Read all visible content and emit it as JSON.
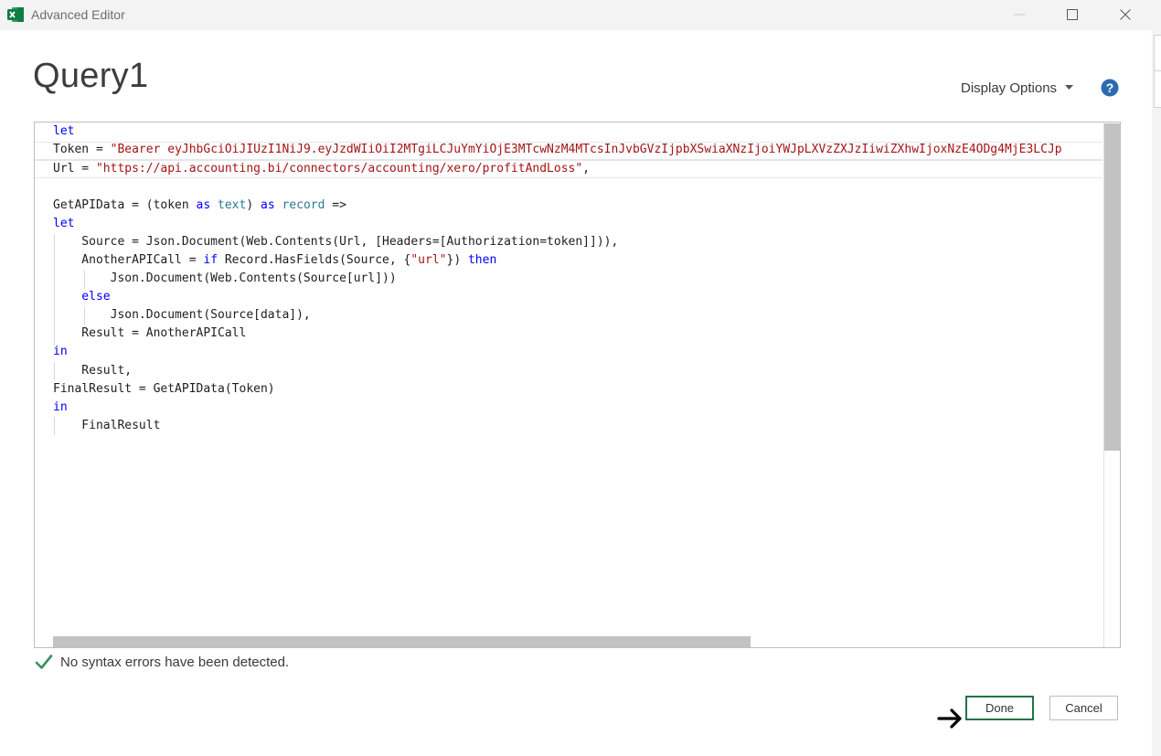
{
  "window": {
    "title": "Advanced Editor",
    "app_icon": "excel-icon",
    "controls": [
      "minimize-icon",
      "maximize-icon",
      "close-icon"
    ]
  },
  "header": {
    "query_name": "Query1",
    "display_options_label": "Display Options",
    "help_icon": "help-icon"
  },
  "code": {
    "line1_let": "let",
    "line2_name": "Token = ",
    "line2_string": "\"Bearer eyJhbGciOiJIUzI1NiJ9.eyJzdWIiOiI2MTgiLCJuYmYiOjE3MTcwNzM4MTcsInJvbGVzIjpbXSwiaXNzIjoiYWJpLXVzZXJzIiwiZXhwIjoxNzE4ODg4MjE3LCJp",
    "line3_name": "Url = ",
    "line3_string": "\"https://api.accounting.bi/connectors/accounting/xero/profitAndLoss\"",
    "line3_tail": ",",
    "line5_a": "GetAPIData = (token ",
    "line5_as1": "as",
    "line5_text": "text",
    "line5_b": ") ",
    "line5_as2": "as",
    "line5_record": "record",
    "line5_c": " =>",
    "line6_let": "let",
    "line7": "    Source = Json.Document(Web.Contents(Url, [Headers=[Authorization=token]])),",
    "line8_a": "    AnotherAPICall = ",
    "line8_if": "if",
    "line8_b": " Record.HasFields(Source, {",
    "line8_str": "\"url\"",
    "line8_c": "}) ",
    "line8_then": "then",
    "line9": "        Json.Document(Web.Contents(Source[url]))",
    "line10_else": "    else",
    "line11": "        Json.Document(Source[data]),",
    "line12": "    Result = AnotherAPICall",
    "line13_in": "in",
    "line14": "    Result,",
    "line15": "FinalResult = GetAPIData(Token)",
    "line16_in": "in",
    "line17": "    FinalResult"
  },
  "status": {
    "icon": "checkmark-icon",
    "message": "No syntax errors have been detected."
  },
  "buttons": {
    "done": "Done",
    "cancel": "Cancel"
  },
  "annotation": {
    "icon": "arrow-right-icon"
  },
  "colors": {
    "keyword": "#0000ff",
    "string": "#a31515",
    "type": "#2b7a8c",
    "accent_green": "#217346",
    "help_blue": "#2b6cb0"
  }
}
